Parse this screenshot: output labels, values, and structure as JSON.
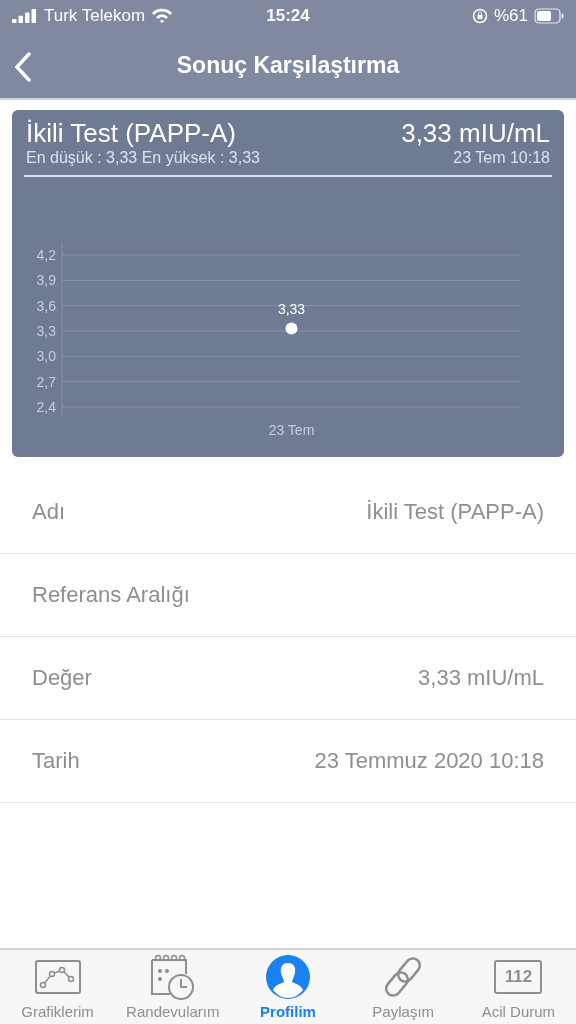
{
  "status_bar": {
    "carrier": "Turk Telekom",
    "time": "15:24",
    "battery": "%61"
  },
  "nav": {
    "title": "Sonuç Karşılaştırma"
  },
  "card": {
    "title": "İkili Test (PAPP-A)",
    "value": "3,33 mIU/mL",
    "range": "En düşük : 3,33 En yüksek : 3,33",
    "date": "23 Tem 10:18",
    "chart_data": {
      "type": "scatter",
      "categories": [
        "23 Tem"
      ],
      "series": [
        {
          "color": "#ffffff",
          "values": [
            3.33
          ]
        }
      ],
      "grid": true,
      "ylim": [
        2.4,
        4.2
      ],
      "yticks": [
        {
          "value": 2.4,
          "label": "2,4"
        },
        {
          "value": 2.7,
          "label": "2,7"
        },
        {
          "value": 3.0,
          "label": "3,0"
        },
        {
          "value": 3.3,
          "label": "3,3"
        },
        {
          "value": 3.6,
          "label": "3,6"
        },
        {
          "value": 3.9,
          "label": "3,9"
        },
        {
          "value": 4.2,
          "label": "4,2"
        }
      ],
      "value_labels": [
        "3,33"
      ]
    }
  },
  "details": [
    {
      "label": "Adı",
      "value": "İkili Test (PAPP-A)"
    },
    {
      "label": "Referans Aralığı"
    },
    {
      "label": "Değer",
      "value": "3,33 mIU/mL"
    },
    {
      "label": "Tarih",
      "value": "23 Temmuz 2020 10:18"
    }
  ],
  "tabs": [
    {
      "kind": "charts",
      "label": "Grafiklerim",
      "selected": false
    },
    {
      "kind": "appointments",
      "label": "Randevularım",
      "selected": false
    },
    {
      "kind": "profile",
      "label": "Profilim",
      "selected": true
    },
    {
      "kind": "share",
      "label": "Paylaşım",
      "selected": false
    },
    {
      "kind": "emergency",
      "label": "Acil Durum",
      "icon_text": "112",
      "selected": false
    }
  ]
}
